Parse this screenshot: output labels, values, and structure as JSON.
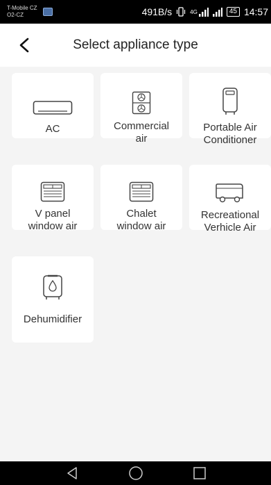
{
  "status_bar": {
    "carrier_line1": "T-Mobile CZ",
    "carrier_line2": "O2-CZ",
    "speed": "491B/s",
    "network": "4G",
    "battery": "45",
    "time": "14:57"
  },
  "header": {
    "title": "Select appliance type"
  },
  "appliances": [
    {
      "label": "AC",
      "icon": "ac-unit-icon"
    },
    {
      "label": "Commercial\nair",
      "icon": "commercial-air-icon"
    },
    {
      "label": "Portable Air\nConditioner",
      "icon": "portable-ac-icon"
    },
    {
      "label": "V panel\nwindow air",
      "icon": "window-unit-icon"
    },
    {
      "label": "Chalet\nwindow air",
      "icon": "window-unit-icon"
    },
    {
      "label": "Recreational\nVerhicle Air",
      "icon": "rv-icon"
    },
    {
      "label": "Dehumidifier",
      "icon": "dehumidifier-icon"
    }
  ],
  "nav": {
    "back": "back-triangle-icon",
    "home": "home-circle-icon",
    "recent": "recent-square-icon"
  }
}
